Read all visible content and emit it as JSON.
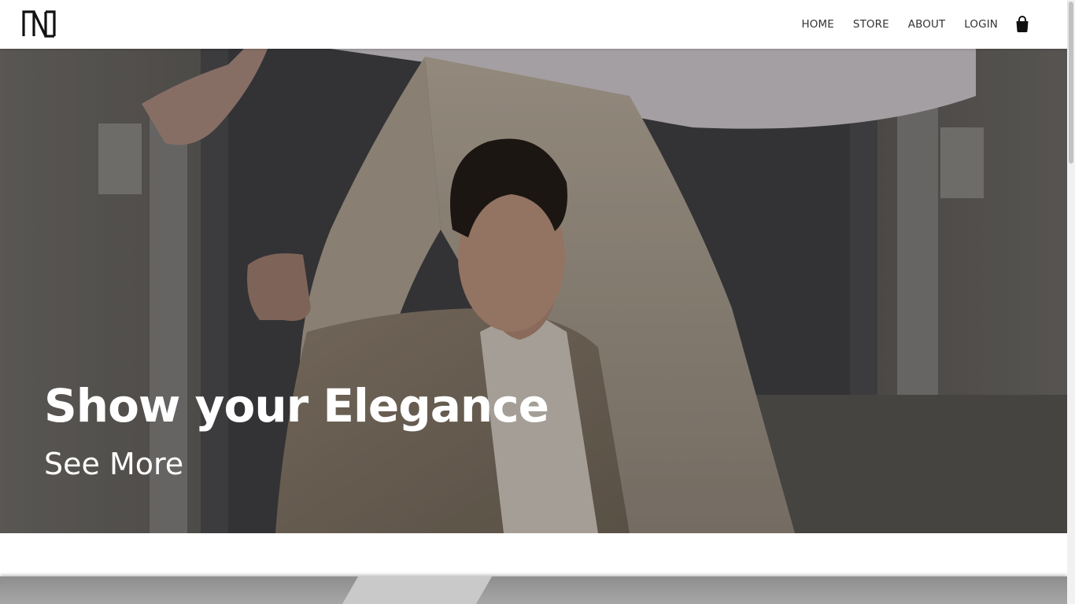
{
  "brand": {
    "logo_icon": "brand-monogram-logo"
  },
  "nav": {
    "items": [
      {
        "label": "HOME"
      },
      {
        "label": "STORE"
      },
      {
        "label": "ABOUT"
      },
      {
        "label": "LOGIN"
      }
    ],
    "cart_icon": "shopping-bag-icon"
  },
  "hero": {
    "title": "Show your Elegance",
    "cta": "See More"
  },
  "colors": {
    "header_bg": "#ffffff",
    "nav_text": "#333333",
    "hero_text": "#ffffff"
  }
}
